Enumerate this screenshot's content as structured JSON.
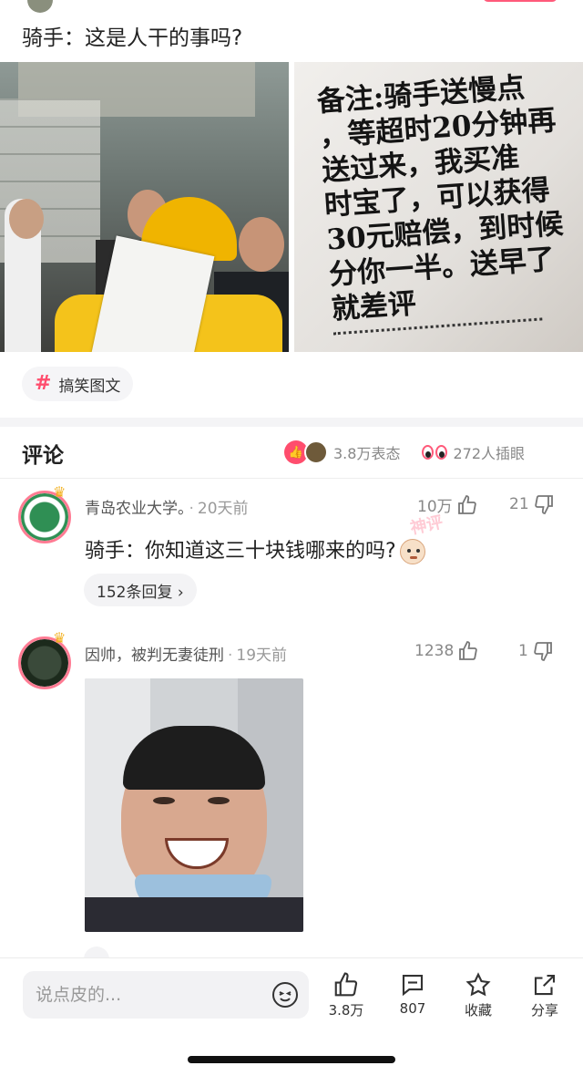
{
  "post": {
    "text": "骑手：这是人干的事吗?",
    "receipt_lines": [
      "备注:骑手送慢点",
      "，等超时20分钟再",
      "送过来，我买准",
      "时宝了，可以获得",
      "30元赔偿，到时候",
      "分你一半。送早了",
      "就差评"
    ],
    "tag": "搞笑图文"
  },
  "comments_header": {
    "title": "评论",
    "reactions": "3.8万表态",
    "watchers": "272人插眼"
  },
  "comments": [
    {
      "author": "青岛农业大学。",
      "time": "20天前",
      "likes": "10万",
      "dislikes": "21",
      "text": "骑手：你知道这三十块钱哪来的吗?",
      "replies": "152条回复 ›"
    },
    {
      "author": "因帅，被判无妻徒刑",
      "time": "19天前",
      "likes": "1238",
      "dislikes": "1"
    }
  ],
  "watermark": "神评",
  "bottom_bar": {
    "input_placeholder": "说点皮的...",
    "like_count": "3.8万",
    "comment_count": "807",
    "favorite_label": "收藏",
    "share_label": "分享"
  },
  "colors": {
    "accent": "#ff4d6d",
    "rider_yellow": "#f4c31b"
  },
  "icons": [
    "hashtag-icon",
    "thumbs-up-icon",
    "thumbs-down-icon",
    "emoji-icon",
    "comment-icon",
    "star-icon",
    "share-icon",
    "crown-icon",
    "eyes-icon"
  ]
}
